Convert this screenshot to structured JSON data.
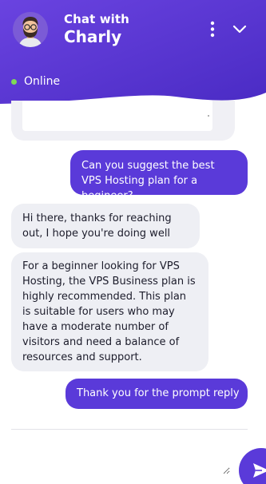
{
  "header": {
    "subtitle": "Chat with",
    "name": "Charly",
    "status": "Online"
  },
  "messages": [
    {
      "sender": "user",
      "text": "Can you suggest the best VPS Hosting plan for a begineer?"
    },
    {
      "sender": "bot",
      "text": "Hi there, thanks for reaching out, I hope you're doing well"
    },
    {
      "sender": "bot",
      "text": "For a beginner looking for VPS Hosting, the VPS Business plan is highly recommended. This plan is suitable for users who may have a moderate number of visitors and need a balance of resources and support."
    },
    {
      "sender": "user",
      "text": "Thank you for the prompt reply"
    }
  ],
  "input": {
    "value": "",
    "placeholder": ""
  },
  "icons": {
    "avatar": "bearded-man-avatar",
    "menu": "kebab-menu-icon",
    "collapse": "chevron-down-icon",
    "send": "send-icon"
  },
  "colors": {
    "primary": "#5a3ad9",
    "header_gradient_start": "#6a43e0",
    "header_gradient_end": "#4a2bc4",
    "bot_bubble": "#eeeff4",
    "online_dot": "#7ed957"
  }
}
